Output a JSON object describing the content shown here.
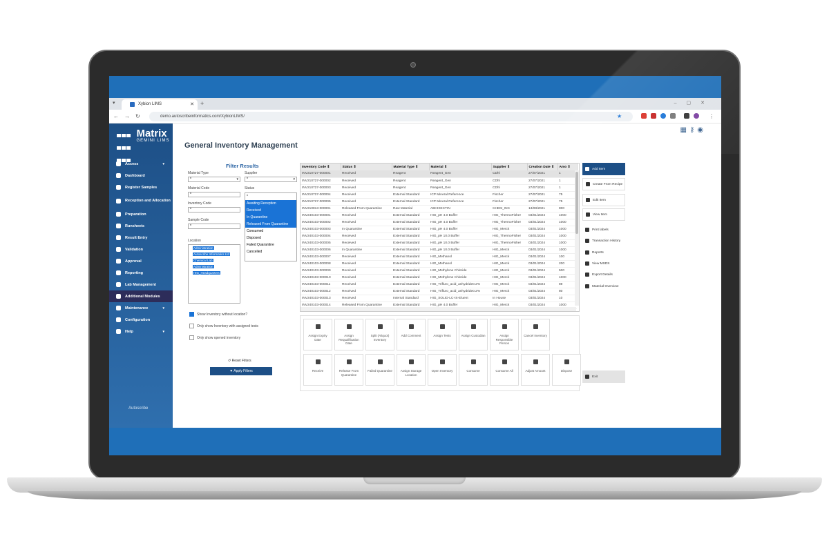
{
  "browser": {
    "tab_title": "Xybion LIMS",
    "url": "demo.autoscribeinformatics.com/XybionLIMS/"
  },
  "app": {
    "logo_title": "Matrix",
    "logo_sub": "GEMINI LIMS",
    "page_title": "General Inventory Management",
    "footer_logo": "Autoscribe"
  },
  "sidebar": {
    "items": [
      {
        "label": "Access",
        "chevron": "▾"
      },
      {
        "label": "Dashboard"
      },
      {
        "label": "Register Samples"
      },
      {
        "label": "Reception and Allocation"
      },
      {
        "label": "Preparation"
      },
      {
        "label": "Runsheets"
      },
      {
        "label": "Result Entry"
      },
      {
        "label": "Validation"
      },
      {
        "label": "Approval"
      },
      {
        "label": "Reporting"
      },
      {
        "label": "Lab Management"
      },
      {
        "label": "Additional Modules"
      },
      {
        "label": "Maintenance",
        "chevron": "▾"
      },
      {
        "label": "Configuration"
      },
      {
        "label": "Help",
        "chevron": "▾"
      }
    ]
  },
  "filters": {
    "title": "Filter Results",
    "material_type_label": "Material Type",
    "material_type_value": "*",
    "supplier_label": "Supplier",
    "supplier_value": "*",
    "material_code_label": "Material Code",
    "material_code_value": "*",
    "status_label": "Status",
    "inventory_code_label": "Inventory Code",
    "inventory_code_value": "*",
    "sample_code_label": "Sample Code",
    "sample_code_value": "*",
    "location_label": "Location",
    "status_options": [
      "*",
      "Awaiting Reception",
      "Received",
      "In Quarantine",
      "Released From Quarantine",
      "Consumed",
      "Disposed",
      "Failed Quarantine",
      "Cancelled"
    ],
    "locations": [
      "Administration",
      "Autoscribe Informatics Ltd",
      "Chemical Lab",
      "Administration",
      "HIG_Headquarters"
    ],
    "check_show_without_location": "Show Inventory without location?",
    "check_assigned_tests": "Only show Inventory with assigned tests",
    "check_opened": "Only show opened inventory",
    "reset_label": "Reset Filters",
    "apply_label": "Apply Filters"
  },
  "table": {
    "columns": [
      "Inventory Code ⇕",
      "Status ⇕",
      "Material Type ⇕",
      "Material ⇕",
      "Supplier ⇕",
      "Creation Date ⇕",
      "Amo ⇕"
    ],
    "rows": [
      [
        "INV210727-000001",
        "Received",
        "Reagent",
        "Reagent_Gen",
        "CDhl",
        "27/07/2021",
        "1"
      ],
      [
        "INV210727-000002",
        "Received",
        "Reagent",
        "Reagent_Gen",
        "CDhl",
        "27/07/2021",
        "1"
      ],
      [
        "INV210727-000003",
        "Received",
        "Reagent",
        "Reagent_Gen",
        "CDhl",
        "27/07/2021",
        "1"
      ],
      [
        "INV210727-000004",
        "Received",
        "External Standard",
        "ICP Mineral Reference",
        "Fischer",
        "27/07/2021",
        "75"
      ],
      [
        "INV210727-000005",
        "Received",
        "External Standard",
        "ICP Mineral Reference",
        "Fischer",
        "27/07/2021",
        "75"
      ],
      [
        "INV210813-000001",
        "Released From Quarantine",
        "Raw Material",
        "ABHIXECTIN",
        "CHEM_INC",
        "13/08/2021",
        "800"
      ],
      [
        "INV240103-000001",
        "Received",
        "External Standard",
        "HIG_pH 4.0 Buffer",
        "HIG_ThermoFisher",
        "03/01/2024",
        "1000"
      ],
      [
        "INV240103-000002",
        "Received",
        "External Standard",
        "HIG_pH 4.0 Buffer",
        "HIG_ThermoFisher",
        "03/01/2024",
        "1000"
      ],
      [
        "INV240103-000003",
        "In Quarantine",
        "External Standard",
        "HIG_pH 4.0 Buffer",
        "HIG_Merck",
        "03/01/2024",
        "1000"
      ],
      [
        "INV240103-000004",
        "Received",
        "External Standard",
        "HIG_pH 10.0 Buffer",
        "HIG_ThermoFisher",
        "03/01/2024",
        "1000"
      ],
      [
        "INV240103-000005",
        "Received",
        "External Standard",
        "HIG_pH 10.0 Buffer",
        "HIG_ThermoFisher",
        "03/01/2024",
        "1000"
      ],
      [
        "INV240103-000006",
        "In Quarantine",
        "External Standard",
        "HIG_pH 10.0 Buffer",
        "HIG_Merck",
        "03/01/2024",
        "1000"
      ],
      [
        "INV240103-000007",
        "Received",
        "External Standard",
        "HIG_Methanol",
        "HIG_Merck",
        "03/01/2024",
        "100"
      ],
      [
        "INV240103-000008",
        "Received",
        "External Standard",
        "HIG_Methanol",
        "HIG_Merck",
        "03/01/2024",
        "200"
      ],
      [
        "INV240103-000009",
        "Received",
        "External Standard",
        "HIG_Methylene Chloride",
        "HIG_Merck",
        "03/01/2024",
        "500"
      ],
      [
        "INV240103-000010",
        "Received",
        "External Standard",
        "HIG_Methylene Chloride",
        "HIG_Merck",
        "03/01/2024",
        "1000"
      ],
      [
        "INV240103-000011",
        "Received",
        "External Standard",
        "HIG_Trifluro_acid_anhydride0.2%",
        "HIG_Merck",
        "03/01/2024",
        "89"
      ],
      [
        "INV240103-000012",
        "Received",
        "External Standard",
        "HIG_Trifluro_acid_anhydride0.2%",
        "HIG_Merck",
        "03/01/2024",
        "80"
      ],
      [
        "INV240103-000013",
        "Received",
        "Internal Standard",
        "HIG_SOLID-LC-IS-Eluent",
        "In House",
        "03/01/2024",
        "10"
      ],
      [
        "INV240103-000014",
        "Released From Quarantine",
        "External Standard",
        "HIG_pH 4.0 Buffer",
        "HIG_Merck",
        "03/01/2024",
        "1000"
      ]
    ]
  },
  "tiles": [
    "Assign Expiry Date",
    "Assign Requalification Date",
    "Split (Aliquot) Inventory",
    "Add Comment",
    "Assign Tests",
    "Assign Custodian",
    "Assign Responsible Person",
    "Cancel Inventory",
    "Receive",
    "Release From Quarantine",
    "Failed Quarantine",
    "Assign Storage Location",
    "Open Inventory",
    "Consume",
    "Consume All",
    "Adjust Amount",
    "Dispose"
  ],
  "actions": [
    "Add Item",
    "Create From Recipe",
    "Edit Item",
    "View Item",
    "Print labels",
    "Transaction History",
    "Reports",
    "View MSDS",
    "Export Details",
    "Material Overview",
    "Exit"
  ],
  "colors": {
    "brand_blue": "#1d4f86",
    "select_blue": "#1a73d6",
    "screen_blue": "#1f6fb8"
  }
}
